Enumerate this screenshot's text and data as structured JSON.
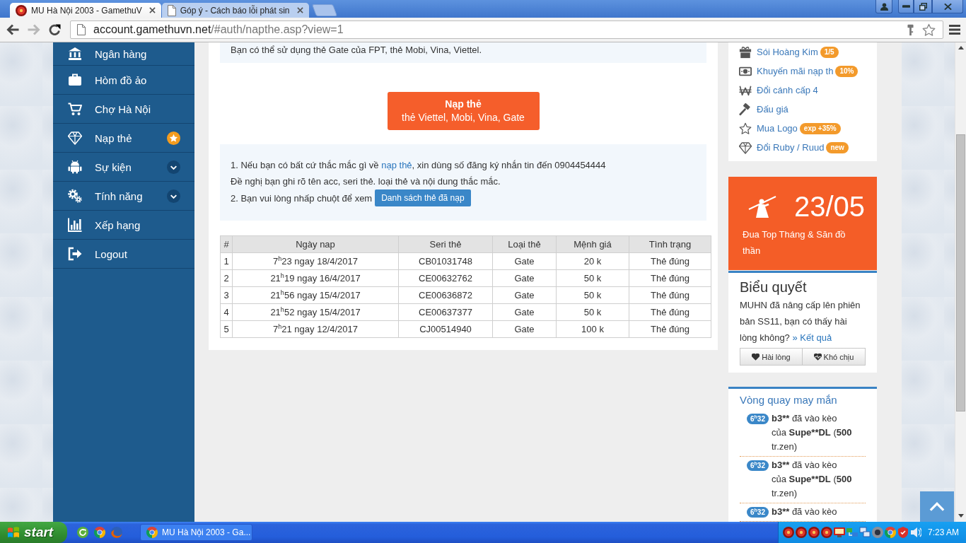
{
  "browser": {
    "tabs": [
      {
        "title": "MU Hà Nội 2003 - GamethuV",
        "selected": true
      },
      {
        "title": "Góp ý - Cách báo lỗi phát sin",
        "selected": false
      }
    ],
    "nav_buttons": [
      {
        "kind": "back",
        "disabled": false
      },
      {
        "kind": "forward",
        "disabled": true
      },
      {
        "kind": "reload",
        "disabled": false
      }
    ],
    "address": {
      "host": "account.gamethuvn.net",
      "path": "/#auth/napthe.asp?view=1"
    }
  },
  "sidebar": {
    "items": [
      {
        "label": "Ngân hàng",
        "kind": "link"
      },
      {
        "label": "Hòm đồ ảo",
        "kind": "link"
      },
      {
        "label": "Chợ Hà Nội",
        "kind": "link"
      },
      {
        "label": "Nạp thẻ",
        "kind": "featured"
      },
      {
        "label": "Sự kiện",
        "kind": "submenu"
      },
      {
        "label": "Tính năng",
        "kind": "submenu"
      },
      {
        "label": "Xếp hạng",
        "kind": "link"
      },
      {
        "label": "Logout",
        "kind": "link"
      }
    ]
  },
  "main": {
    "notice": "Bạn có thể sử dụng thẻ Gate của FPT, thẻ Mobi, Vina, Viettel.",
    "recharge_button": {
      "title": "Nạp thẻ",
      "subtitle": "thẻ Viettel, Mobi, Vina, Gate"
    },
    "help": {
      "line_1": {
        "before": "1. Nếu bạn có bất cứ thắc mắc gì về ",
        "link": "nạp thẻ",
        "after": ", xin dùng số đăng ký nhắn tin đến 0904454444"
      },
      "line_2": "Đề nghị bạn ghi rõ tên acc, seri thẻ. loại thẻ và nội dung thắc mắc.",
      "line_3": "2. Bạn vui lòng nhấp chuột để xem",
      "history_button": "Danh sách thẻ đã nạp"
    },
    "table": {
      "columns": [
        "#",
        "Ngày nap",
        "Seri thẻ",
        "Loại thẻ",
        "Mệnh giá",
        "Tình trạng"
      ],
      "rows": [
        [
          "1",
          "7$^{h}$23 ngay 18/4/2017",
          "CB01031748",
          "Gate",
          "20 k",
          "Thẻ đúng"
        ],
        [
          "2",
          "21$^{h}$19 ngay 16/4/2017",
          "CE00632762",
          "Gate",
          "50 k",
          "Thẻ đúng"
        ],
        [
          "3",
          "21$^{h}$56 ngay 15/4/2017",
          "CE00636872",
          "Gate",
          "50 k",
          "Thẻ đúng"
        ],
        [
          "4",
          "21$^{h}$52 ngay 15/4/2017",
          "CE00637377",
          "Gate",
          "50 k",
          "Thẻ đúng"
        ],
        [
          "5",
          "7$^{h}$21 ngay 12/4/2017",
          "CJ00514940",
          "Gate",
          "100 k",
          "Thẻ đúng"
        ]
      ]
    }
  },
  "right": {
    "links": [
      {
        "label": "Sói Hoàng Kim",
        "badge": "1/5"
      },
      {
        "label": "Khuyến mãi nạp th",
        "badge": "10%"
      },
      {
        "label": "Đổi cánh cấp 4"
      },
      {
        "label": "Đấu giá"
      },
      {
        "label": "Mua Logo",
        "badge": "exp +35%"
      },
      {
        "label": "Đổi Ruby / Ruud",
        "badge": "new"
      }
    ],
    "event": {
      "date": "23/05",
      "caption": "Đua Top Tháng & Săn đồ thần"
    },
    "poll": {
      "title": "Biểu quyết",
      "question": "MUHN đã nâng cấp lên phiên bản SS11, bạn có thấy hài lòng không?",
      "results_link": "» Kết quả",
      "options": [
        "Hài lòng",
        "Khó chịu"
      ]
    },
    "lucky_wheel": {
      "title": "Vòng quay may mắn",
      "entries": [
        {
          "time": "6$^{h}$32",
          "segments": [
            {
              "text": "b3**",
              "bold": true
            },
            {
              "text": " đã vào kèo của ",
              "bold": false
            },
            {
              "text": "Supe**DL",
              "bold": true
            },
            {
              "text": " (",
              "bold": false
            },
            {
              "text": "500",
              "bold": true
            },
            {
              "text": " tr.zen)",
              "bold": false
            }
          ]
        },
        {
          "time": "6$^{h}$32",
          "segments": [
            {
              "text": "b3**",
              "bold": true
            },
            {
              "text": " đã vào kèo của ",
              "bold": false
            },
            {
              "text": "Supe**DL",
              "bold": true
            },
            {
              "text": " (",
              "bold": false
            },
            {
              "text": "500",
              "bold": true
            },
            {
              "text": " tr.zen)",
              "bold": false
            }
          ]
        },
        {
          "time": "6$^{h}$32",
          "segments": [
            {
              "text": "b3**",
              "bold": true
            },
            {
              "text": " đã vào kèo",
              "bold": false
            }
          ]
        }
      ]
    }
  },
  "taskbar": {
    "start_label": "start",
    "tasks": [
      "MU Hà Nội 2003 - Ga..."
    ],
    "clock": "7:23 AM"
  }
}
